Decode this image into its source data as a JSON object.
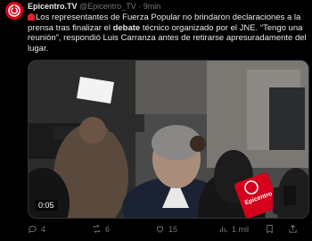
{
  "header": {
    "display_name": "Epicentro.TV",
    "handle": "@Epicentro_TV",
    "separator": "·",
    "time": "9min"
  },
  "tweet": {
    "part1": "Los representantes de Fuerza Popular no brindaron declaraciones a la prensa tras finalizar el ",
    "bold": "debate",
    "part2": " técnico organizado por el JNE. “Tengo una reunión”, respondió Luis Carranza antes de retirarse apresuradamente del lugar."
  },
  "media": {
    "duration": "0:05",
    "mic_logo_text": "Epicentro"
  },
  "actions": {
    "replies": "4",
    "reposts": "6",
    "likes": "15",
    "views": "1 mil"
  },
  "colors": {
    "brand_red": "#d6001c",
    "text": "#e7e9ea",
    "muted": "#71767b"
  }
}
